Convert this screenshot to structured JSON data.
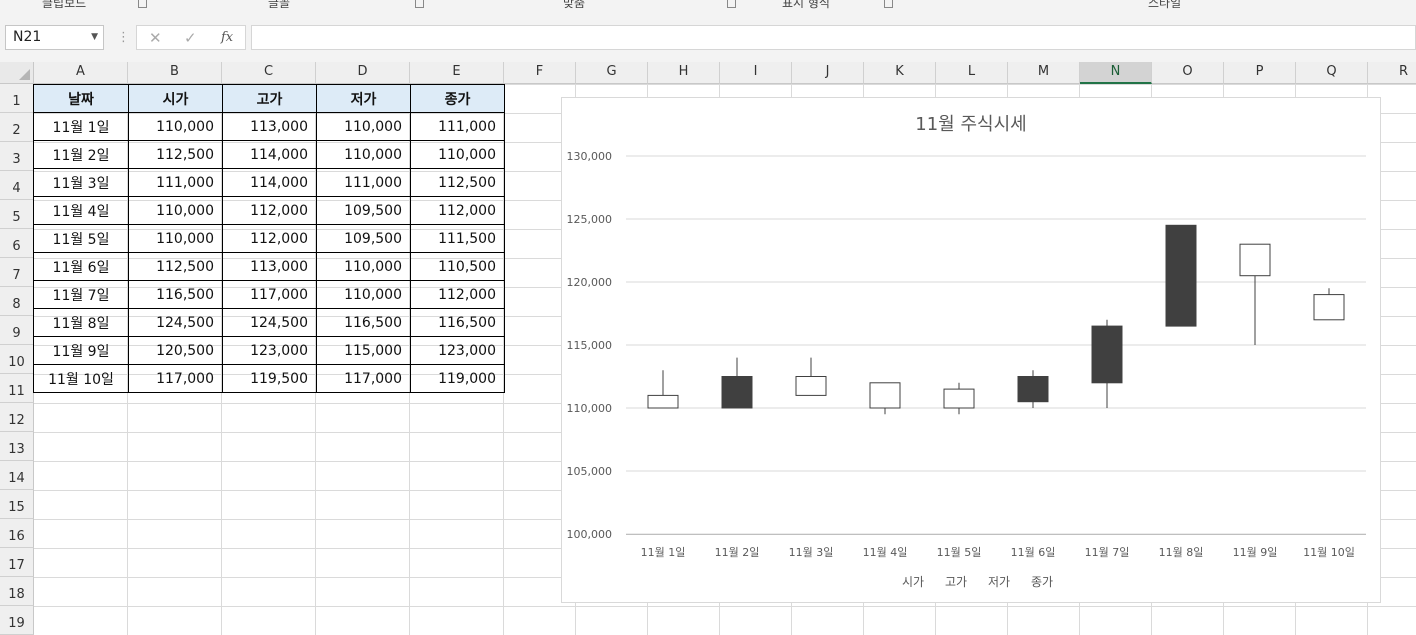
{
  "ribbon": {
    "groups": [
      {
        "label": "클립보드"
      },
      {
        "label": "글꼴"
      },
      {
        "label": "맞춤"
      },
      {
        "label": "표시 형식"
      },
      {
        "label": "스타일"
      }
    ]
  },
  "formula_bar": {
    "name_box": "N21",
    "cancel_icon": "✕",
    "enter_icon": "✓",
    "function_icon": "fx",
    "formula": ""
  },
  "columns": [
    "A",
    "B",
    "C",
    "D",
    "E",
    "F",
    "G",
    "H",
    "I",
    "J",
    "K",
    "L",
    "M",
    "N",
    "O",
    "P",
    "Q",
    "R"
  ],
  "selected_column": "N",
  "rows": [
    "1",
    "2",
    "3",
    "4",
    "5",
    "6",
    "7",
    "8",
    "9",
    "10",
    "11",
    "12",
    "13",
    "14",
    "15",
    "16",
    "17",
    "18",
    "19"
  ],
  "table": {
    "headers": [
      "날짜",
      "시가",
      "고가",
      "저가",
      "종가"
    ],
    "rows": [
      [
        "11월 1일",
        "110,000",
        "113,000",
        "110,000",
        "111,000"
      ],
      [
        "11월 2일",
        "112,500",
        "114,000",
        "110,000",
        "110,000"
      ],
      [
        "11월 3일",
        "111,000",
        "114,000",
        "111,000",
        "112,500"
      ],
      [
        "11월 4일",
        "110,000",
        "112,000",
        "109,500",
        "112,000"
      ],
      [
        "11월 5일",
        "110,000",
        "112,000",
        "109,500",
        "111,500"
      ],
      [
        "11월 6일",
        "112,500",
        "113,000",
        "110,000",
        "110,500"
      ],
      [
        "11월 7일",
        "116,500",
        "117,000",
        "110,000",
        "112,000"
      ],
      [
        "11월 8일",
        "124,500",
        "124,500",
        "116,500",
        "116,500"
      ],
      [
        "11월 9일",
        "120,500",
        "123,000",
        "115,000",
        "123,000"
      ],
      [
        "11월 10일",
        "117,000",
        "119,500",
        "117,000",
        "119,000"
      ]
    ]
  },
  "chart_data": {
    "type": "candlestick",
    "title": "11월 주식시세",
    "categories": [
      "11월 1일",
      "11월 2일",
      "11월 3일",
      "11월 4일",
      "11월 5일",
      "11월 6일",
      "11월 7일",
      "11월 8일",
      "11월 9일",
      "11월 10일"
    ],
    "open": [
      110000,
      112500,
      111000,
      110000,
      110000,
      112500,
      116500,
      124500,
      120500,
      117000
    ],
    "high": [
      113000,
      114000,
      114000,
      112000,
      112000,
      113000,
      117000,
      124500,
      123000,
      119500
    ],
    "low": [
      110000,
      110000,
      111000,
      109500,
      109500,
      110000,
      110000,
      116500,
      115000,
      117000
    ],
    "close": [
      111000,
      110000,
      112500,
      112000,
      111500,
      110500,
      112000,
      116500,
      123000,
      119000
    ],
    "ylim": [
      100000,
      130000
    ],
    "yticks": [
      "130,000",
      "125,000",
      "120,000",
      "115,000",
      "110,000",
      "105,000",
      "100,000"
    ],
    "ytick_values": [
      130000,
      125000,
      120000,
      115000,
      110000,
      105000,
      100000
    ],
    "legend": [
      "시가",
      "고가",
      "저가",
      "종가"
    ],
    "legend_position": "bottom",
    "grid": true,
    "up_color": "#ffffff",
    "down_color": "#404040"
  }
}
